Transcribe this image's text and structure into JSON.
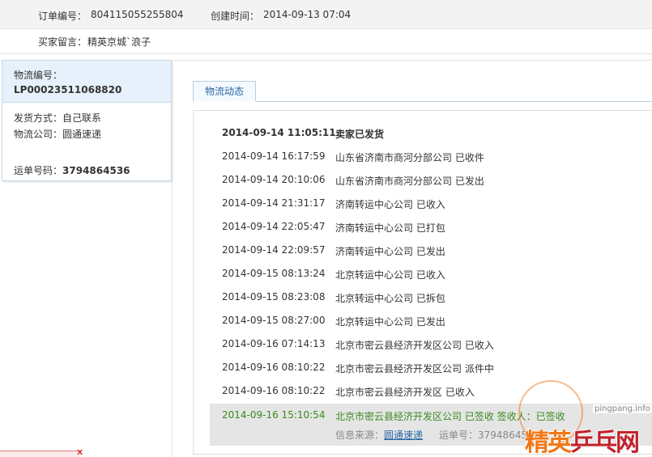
{
  "order": {
    "number_label": "订单编号：",
    "number": "804115055255804",
    "created_label": "创建时间：",
    "created": "2014-09-13 07:04",
    "buyer_msg_label": "买家留言：",
    "buyer_msg": "精英京城`浪子"
  },
  "logistics": {
    "id_label": "物流编号：",
    "id": "LP00023511068820",
    "ship_method_label": "发货方式：",
    "ship_method": "自己联系",
    "company_label": "物流公司：",
    "company": "圆通速递",
    "waybill_label": "运单号码：",
    "waybill": "3794864536"
  },
  "tab": {
    "label": "物流动态"
  },
  "tracking": [
    {
      "time": "2014-09-14 11:05:11",
      "desc": "卖家已发货"
    },
    {
      "time": "2014-09-14 16:17:59",
      "desc": "山东省济南市商河分部公司 已收件"
    },
    {
      "time": "2014-09-14 20:10:06",
      "desc": "山东省济南市商河分部公司 已发出"
    },
    {
      "time": "2014-09-14 21:31:17",
      "desc": "济南转运中心公司 已收入"
    },
    {
      "time": "2014-09-14 22:05:47",
      "desc": "济南转运中心公司 已打包"
    },
    {
      "time": "2014-09-14 22:09:57",
      "desc": "济南转运中心公司 已发出"
    },
    {
      "time": "2014-09-15 08:13:24",
      "desc": "北京转运中心公司 已收入"
    },
    {
      "time": "2014-09-15 08:23:08",
      "desc": "北京转运中心公司 已拆包"
    },
    {
      "time": "2014-09-15 08:27:00",
      "desc": "北京转运中心公司 已发出"
    },
    {
      "time": "2014-09-16 07:14:13",
      "desc": "北京市密云县经济开发区公司 已收入"
    },
    {
      "time": "2014-09-16 08:10:22",
      "desc": "北京市密云县经济开发区公司 派件中"
    },
    {
      "time": "2014-09-16 08:10:22",
      "desc": "北京市密云县经济开发区 已收入"
    }
  ],
  "latest": {
    "time": "2014-09-16 15:10:54",
    "desc": "北京市密云县经济开发区公司 已签收 签收人：已签收",
    "source_label": "信息来源：",
    "source": "圆通速递",
    "waybill_label": "运单号：",
    "waybill": "3794864536"
  },
  "watermark": {
    "site": "pingpang.info",
    "logo_a": "精英",
    "logo_b": "乒乓网"
  },
  "colors": {
    "accent": "#2a66a5",
    "latest_green": "#3a8a1e",
    "watermark": "#f07818"
  }
}
